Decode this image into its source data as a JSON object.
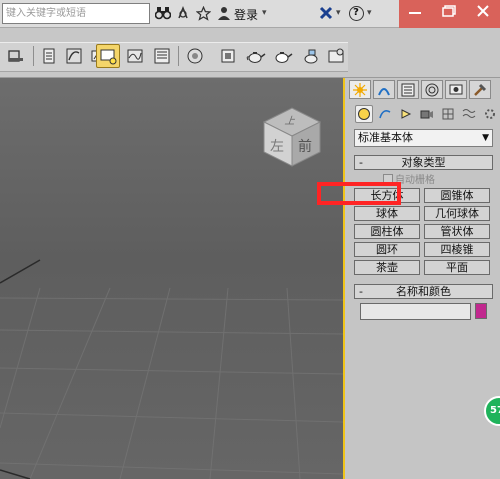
{
  "titlebar": {
    "search_placeholder": "键入关键字或短语",
    "login_label": "登录",
    "help_label": "?"
  },
  "toolbar": {
    "tools": [
      "undo-icon",
      "layer-icon",
      "curve-icon",
      "schematic-icon",
      "material-icon",
      "render-setup-icon",
      "render-frame-icon",
      "render-icon",
      "teapot-icon",
      "teapot-render-icon",
      "environment-icon"
    ]
  },
  "viewport": {
    "viewcube_left": "左",
    "viewcube_front": "前",
    "viewcube_top": "上"
  },
  "command_panel": {
    "category_select": "标准基本体",
    "object_type_title": "对象类型",
    "autogrid_label": "自动栅格",
    "object_buttons": [
      "长方体",
      "圆锥体",
      "球体",
      "几何球体",
      "圆柱体",
      "管状体",
      "圆环",
      "四棱锥",
      "茶壶",
      "平面"
    ],
    "name_color_title": "名称和颜色",
    "name_value": "",
    "color_swatch": "#c1288e"
  },
  "highlight_color": "#ff2424",
  "badge_label": "57"
}
